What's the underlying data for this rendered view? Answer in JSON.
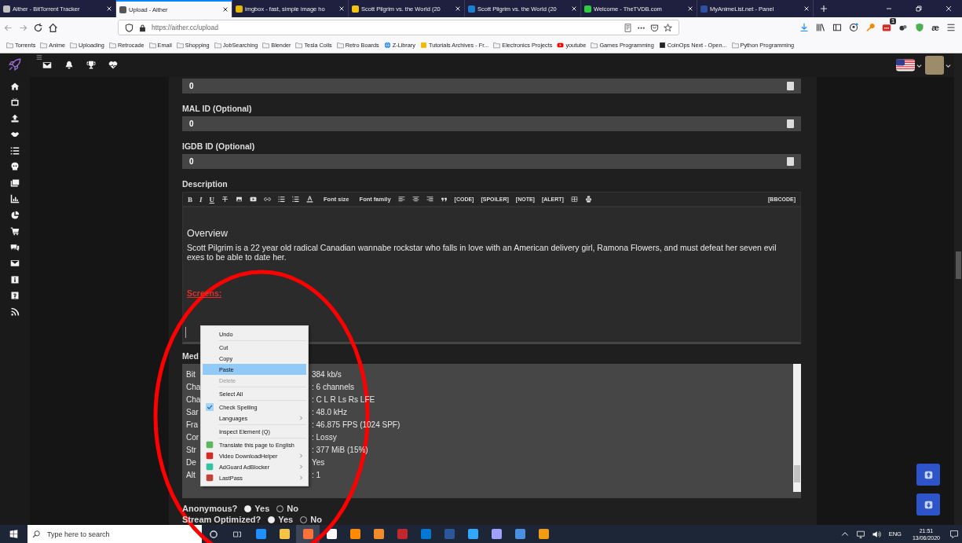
{
  "browser": {
    "tabs": [
      {
        "title": "Aither - BitTorrent Tracker",
        "selected": false
      },
      {
        "title": "Upload - Aither",
        "selected": true
      },
      {
        "title": "imgbox - fast, simple image ho",
        "selected": false
      },
      {
        "title": "Scott Pilgrim vs. the World (20",
        "selected": false
      },
      {
        "title": "Scott Pilgrim vs. the World (20",
        "selected": false
      },
      {
        "title": "Welcome - TheTVDB.com",
        "selected": false
      },
      {
        "title": "MyAnimeList.net - Panel",
        "selected": false
      }
    ],
    "url": "https://aither.cc/upload",
    "lastpass_badge": "1",
    "extension_label": "æ",
    "bookmarks": [
      {
        "label": "Torrents",
        "kind": "folder"
      },
      {
        "label": "Anime",
        "kind": "folder"
      },
      {
        "label": "Uploading",
        "kind": "folder"
      },
      {
        "label": "Retrocade",
        "kind": "folder"
      },
      {
        "label": "Email",
        "kind": "folder"
      },
      {
        "label": "Shopping",
        "kind": "folder"
      },
      {
        "label": "JobSearching",
        "kind": "folder"
      },
      {
        "label": "Blender",
        "kind": "folder"
      },
      {
        "label": "Tesla Coils",
        "kind": "folder"
      },
      {
        "label": "Retro Boards",
        "kind": "folder"
      },
      {
        "label": "Z-Library",
        "kind": "globe"
      },
      {
        "label": "Tutorials Archives - Fr...",
        "kind": "site"
      },
      {
        "label": "Electronics Projects",
        "kind": "folder"
      },
      {
        "label": "youtube",
        "kind": "video"
      },
      {
        "label": "Games Programming",
        "kind": "folder"
      },
      {
        "label": "CoinOps Next - Open...",
        "kind": "site"
      },
      {
        "label": "Python Programming",
        "kind": "folder"
      }
    ]
  },
  "form": {
    "top_field_value": "0",
    "fields": [
      {
        "label": "MAL ID (Optional)",
        "value": "0"
      },
      {
        "label": "IGDB ID (Optional)",
        "value": "0"
      }
    ],
    "description": {
      "label": "Description",
      "format_letters": [
        "B",
        "I",
        "U"
      ],
      "font_size": "Font size",
      "font_family": "Font family",
      "tags": [
        "[CODE]",
        "[SPOILER]",
        "[NOTE]",
        "[ALERT]"
      ],
      "bbcode": "[BBCODE]",
      "heading": "Overview",
      "body": "Scott Pilgrim is a 22 year old radical Canadian wannabe rockstar who falls in love with an American delivery girl, Ramona Flowers, and must defeat her seven evil exes to be able to date her.",
      "screens": "Screens:"
    },
    "mediainfo": {
      "label": "Med",
      "rows": [
        {
          "key": "Bit",
          "value": "384 kb/s"
        },
        {
          "key": "Cha",
          "value": ": 6 channels"
        },
        {
          "key": "Cha",
          "value": ": C L R Ls Rs LFE"
        },
        {
          "key": "Sar",
          "value": ": 48.0 kHz"
        },
        {
          "key": "Fra",
          "value": ": 46.875 FPS (1024 SPF)"
        },
        {
          "key": "Cor",
          "value": ": Lossy"
        },
        {
          "key": "Str",
          "value": ": 377 MiB (15%)"
        },
        {
          "key": "De",
          "value": "Yes"
        },
        {
          "key": "Alt",
          "value": ": 1"
        }
      ]
    },
    "options": [
      {
        "label": "Anonymous?",
        "choices": [
          {
            "label": "Yes",
            "selected": true
          },
          {
            "label": "No",
            "selected": false
          }
        ]
      },
      {
        "label": "Stream Optimized?",
        "choices": [
          {
            "label": "Yes",
            "selected": true
          },
          {
            "label": "No",
            "selected": false
          }
        ]
      }
    ]
  },
  "context_menu": [
    {
      "kind": "item",
      "label": "Undo",
      "selected": false,
      "disabled": false,
      "checked": false,
      "submenu": false
    },
    {
      "kind": "separator"
    },
    {
      "kind": "item",
      "label": "Cut",
      "selected": false,
      "disabled": false,
      "checked": false,
      "submenu": false
    },
    {
      "kind": "item",
      "label": "Copy",
      "selected": false,
      "disabled": false,
      "checked": false,
      "submenu": false
    },
    {
      "kind": "item",
      "label": "Paste",
      "selected": true,
      "disabled": false,
      "checked": false,
      "submenu": false
    },
    {
      "kind": "item",
      "label": "Delete",
      "selected": false,
      "disabled": true,
      "checked": false,
      "submenu": false
    },
    {
      "kind": "separator"
    },
    {
      "kind": "item",
      "label": "Select All",
      "selected": false,
      "disabled": false,
      "checked": false,
      "submenu": false
    },
    {
      "kind": "separator"
    },
    {
      "kind": "item",
      "label": "Check Spelling",
      "selected": false,
      "disabled": false,
      "checked": true,
      "submenu": false
    },
    {
      "kind": "item",
      "label": "Languages",
      "selected": false,
      "disabled": false,
      "checked": false,
      "submenu": true
    },
    {
      "kind": "separator"
    },
    {
      "kind": "item",
      "label": "Inspect Element (Q)",
      "selected": false,
      "disabled": false,
      "checked": false,
      "submenu": false
    },
    {
      "kind": "separator"
    },
    {
      "kind": "extension",
      "label": "Translate this page to English",
      "selected": false,
      "disabled": false,
      "checked": false,
      "submenu": false
    },
    {
      "kind": "extension",
      "label": "Video DownloadHelper",
      "selected": false,
      "disabled": false,
      "checked": false,
      "submenu": true
    },
    {
      "kind": "extension",
      "label": "AdGuard AdBlocker",
      "selected": false,
      "disabled": false,
      "checked": false,
      "submenu": true
    },
    {
      "kind": "extension",
      "label": "LastPass",
      "selected": false,
      "disabled": false,
      "checked": false,
      "submenu": true
    }
  ],
  "taskbar": {
    "search_placeholder": "Type here to search",
    "language": "ENG",
    "time": "21:51",
    "date": "13/06/2020"
  }
}
